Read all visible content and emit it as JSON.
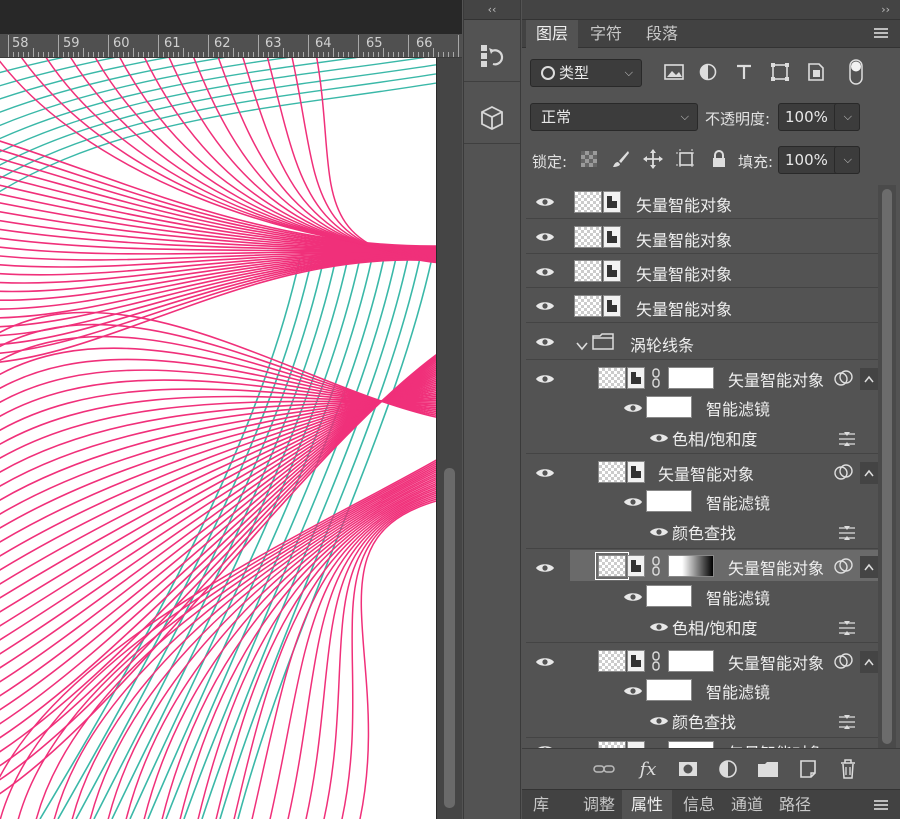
{
  "ruler": {
    "labels": [
      "58",
      "59",
      "60",
      "61",
      "62",
      "63",
      "64",
      "65",
      "66"
    ]
  },
  "panel": {
    "collapse_glyph": "››",
    "tool_collapse_glyph": "‹‹",
    "tabs": [
      "图层",
      "字符",
      "段落"
    ],
    "filter": {
      "kind_label": "类型",
      "icons": [
        "image-filter-icon",
        "adjustment-filter-icon",
        "type-filter-icon",
        "shape-filter-icon",
        "smart-object-filter-icon",
        "filter-toggle-icon"
      ]
    },
    "blend_mode": "正常",
    "opacity_label": "不透明度:",
    "opacity_value": "100%",
    "lock_label": "锁定:",
    "fill_label": "填充:",
    "fill_value": "100%",
    "layers": [
      {
        "name": "矢量智能对象"
      },
      {
        "name": "矢量智能对象"
      },
      {
        "name": "矢量智能对象"
      },
      {
        "name": "矢量智能对象"
      },
      {
        "name": "涡轮线条",
        "type": "group"
      },
      {
        "name": "矢量智能对象",
        "filters_label": "智能滤镜",
        "filter": "色相/饱和度"
      },
      {
        "name": "矢量智能对象",
        "filters_label": "智能滤镜",
        "filter": "颜色查找"
      },
      {
        "name": "矢量智能对象",
        "filters_label": "智能滤镜",
        "filter": "色相/饱和度",
        "selected": true
      },
      {
        "name": "矢量智能对象",
        "filters_label": "智能滤镜",
        "filter": "颜色查找"
      },
      {
        "name": "矢量智能对象"
      }
    ],
    "bottom_tabs": [
      "库",
      "调整",
      "属性",
      "信息",
      "通道",
      "路径"
    ],
    "active_bottom_tab": "属性"
  },
  "colors": {
    "pink_line": "#f0307a",
    "teal_line": "#3ab8a8",
    "selected_row": "#6a6a6a"
  }
}
